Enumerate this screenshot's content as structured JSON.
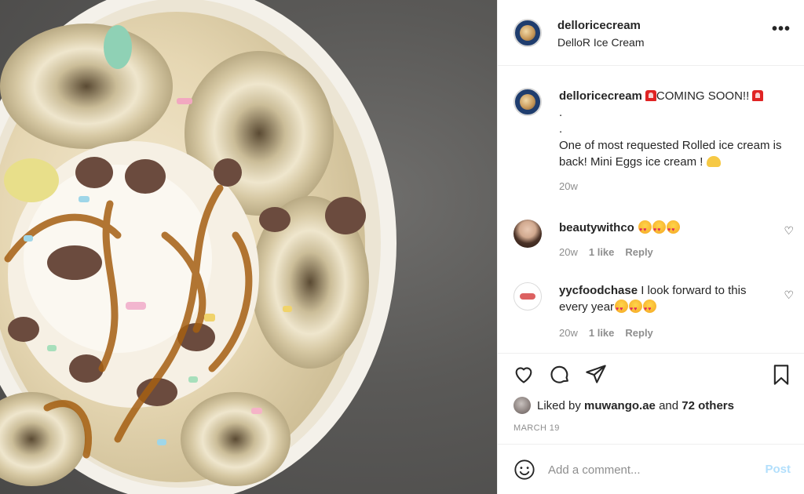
{
  "photo": {
    "alt_subject": "rolled ice cream bowl"
  },
  "header": {
    "username": "delloricecream",
    "subtitle": "DelloR Ice Cream",
    "more_icon": "more-horizontal-icon"
  },
  "caption": {
    "username": "delloricecream",
    "line1": "COMING SOON!!",
    "dot1": ".",
    "dot2": ".",
    "body": "One of most requested Rolled ice cream is back! Mini Eggs ice cream !",
    "time": "20w"
  },
  "comments": [
    {
      "username": "beautywithco",
      "text": "",
      "time": "20w",
      "likes": "1 like",
      "reply": "Reply"
    },
    {
      "username": "yycfoodchase",
      "text": "I look forward to this every year",
      "time": "20w",
      "likes": "1 like",
      "reply": "Reply"
    }
  ],
  "actions": {
    "icons": [
      "heart-icon",
      "comment-icon",
      "share-icon",
      "bookmark-icon"
    ],
    "liked_by_prefix": "Liked by",
    "liked_by_user": "muwango.ae",
    "liked_by_and": "and",
    "liked_by_others": "72 others",
    "date": "MARCH 19"
  },
  "add_comment": {
    "placeholder": "Add a comment...",
    "post_label": "Post"
  },
  "colors": {
    "accent_post_disabled": "#b2dffc",
    "text": "#262626",
    "muted": "#8e8e8e"
  }
}
